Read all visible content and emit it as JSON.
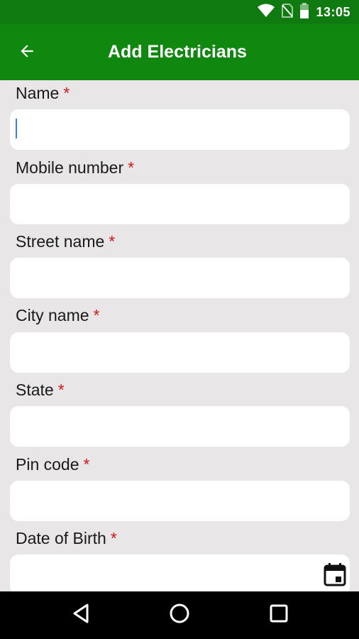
{
  "status_bar": {
    "time": "13:05",
    "icons": [
      "wifi-icon",
      "no-sim-icon",
      "battery-icon"
    ]
  },
  "app_bar": {
    "title": "Add Electricians",
    "back_icon": "arrow-left-icon"
  },
  "form": {
    "required_marker": "*",
    "fields": [
      {
        "label": "Name",
        "value": "",
        "focused": true
      },
      {
        "label": "Mobile number",
        "value": ""
      },
      {
        "label": "Street name",
        "value": ""
      },
      {
        "label": "City name",
        "value": ""
      },
      {
        "label": "State",
        "value": ""
      },
      {
        "label": "Pin code",
        "value": ""
      },
      {
        "label": "Date of Birth",
        "value": "",
        "trailing_icon": "calendar-icon"
      }
    ]
  },
  "nav_bar": {
    "icons": [
      "back-triangle-icon",
      "home-circle-icon",
      "recents-square-icon"
    ]
  },
  "colors": {
    "status_bar": "#0f7a0f",
    "app_bar": "#108810",
    "background": "#e8e6e6",
    "required": "#d01818",
    "cursor": "#3b82e0"
  }
}
